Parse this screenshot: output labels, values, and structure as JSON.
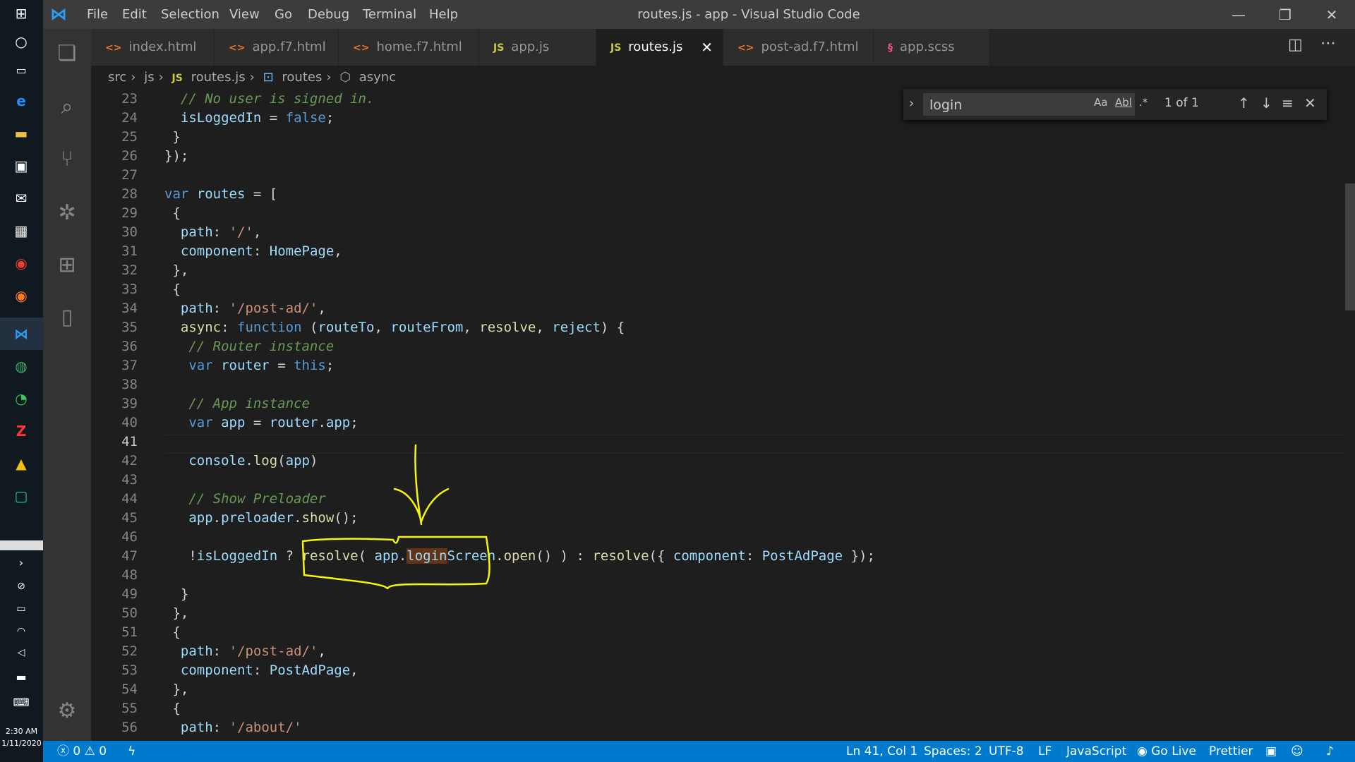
{
  "taskbar": {
    "time": "2:30 AM",
    "date": "1/11/2020",
    "icons": [
      "windows-start-icon",
      "cortana-search-icon",
      "task-view-icon",
      "edge-icon",
      "file-explorer-icon",
      "store-icon",
      "mail-icon",
      "calculator-icon",
      "chrome-icon",
      "firefox-icon",
      "vscode-icon",
      "browser-icon",
      "whatsapp-icon",
      "filezilla-icon",
      "drive-icon",
      "ide-icon"
    ]
  },
  "menu": {
    "items": [
      "File",
      "Edit",
      "Selection",
      "View",
      "Go",
      "Debug",
      "Terminal",
      "Help"
    ]
  },
  "window": {
    "title": "routes.js - app - Visual Studio Code"
  },
  "tabs": [
    {
      "label": "index.html",
      "icon": "<>",
      "color": "#e37933"
    },
    {
      "label": "app.f7.html",
      "icon": "<>",
      "color": "#e37933"
    },
    {
      "label": "home.f7.html",
      "icon": "<>",
      "color": "#e37933"
    },
    {
      "label": "app.js",
      "icon": "JS",
      "color": "#cbcb41"
    },
    {
      "label": "routes.js",
      "icon": "JS",
      "color": "#cbcb41"
    },
    {
      "label": "post-ad.f7.html",
      "icon": "<>",
      "color": "#e37933"
    },
    {
      "label": "app.scss",
      "icon": "§",
      "color": "#f55385"
    }
  ],
  "breadcrumb": {
    "items": [
      "src",
      "js",
      "routes.js",
      "routes",
      "async"
    ]
  },
  "find": {
    "query": "login",
    "count": "1 of 1",
    "opt_case": "Aa",
    "opt_word": "Abl",
    "opt_regex": ".*"
  },
  "code": {
    "lines": [
      23,
      24,
      25,
      26,
      27,
      28,
      29,
      30,
      31,
      32,
      33,
      34,
      35,
      36,
      37,
      38,
      39,
      40,
      41,
      42,
      43,
      44,
      45,
      46,
      47,
      48,
      49,
      50,
      51,
      52,
      53,
      54,
      55,
      56
    ]
  },
  "status": {
    "errors": "0",
    "warnings": "0",
    "position": "Ln 41, Col 1",
    "spaces": "Spaces: 2",
    "encoding": "UTF-8",
    "eol": "LF",
    "language": "JavaScript",
    "golive": "Go Live",
    "prettier": "Prettier"
  }
}
